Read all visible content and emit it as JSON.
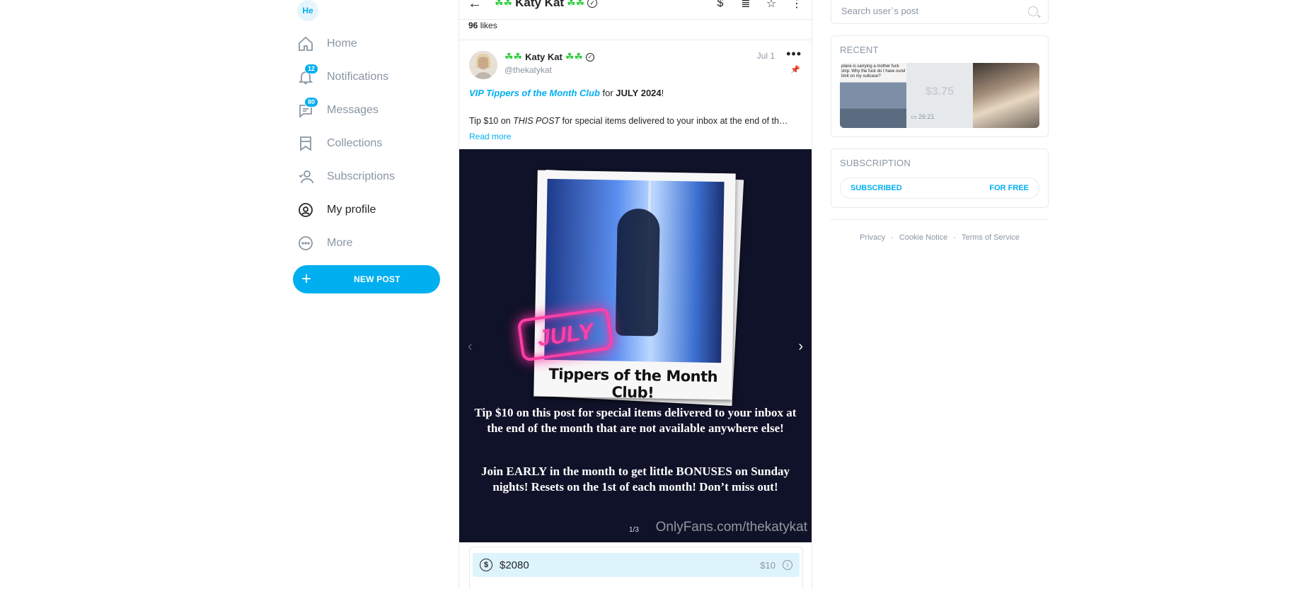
{
  "sidebar": {
    "avatar_initials": "He",
    "items": [
      {
        "label": "Home",
        "icon": "home-icon"
      },
      {
        "label": "Notifications",
        "icon": "bell-icon",
        "badge": "12"
      },
      {
        "label": "Messages",
        "icon": "message-icon",
        "badge": "80"
      },
      {
        "label": "Collections",
        "icon": "bookmark-icon"
      },
      {
        "label": "Subscriptions",
        "icon": "subscriptions-icon"
      },
      {
        "label": "My profile",
        "icon": "profile-icon",
        "active": true
      },
      {
        "label": "More",
        "icon": "more-icon"
      }
    ],
    "new_post_label": "NEW POST"
  },
  "topbar": {
    "title": "Katy Kat",
    "decor": "☘ ☘"
  },
  "post": {
    "likes_count": "96",
    "likes_label": "likes",
    "author_name": "Katy Kat",
    "author_handle": "@thekatykat",
    "date": "Jul 1",
    "text_link": "VIP Tippers of the Month Club",
    "text_for": " for ",
    "text_month": "JULY 2024",
    "text_excl": "!",
    "text_line2_pre": "Tip $10 on ",
    "text_line2_em": "THIS POST",
    "text_line2_post": " for special items delivered to your inbox at the end of th…",
    "read_more": "Read more",
    "media": {
      "stamp": "JULY",
      "caption": "Tippers of the Month Club!",
      "body1": "Tip $10 on this post for special items delivered to your inbox at the end of the month that are not available anywhere else!",
      "body2": "Join EARLY in the month to get little BONUSES on Sunday nights!  Resets on the 1st of each month! Don’t miss out!",
      "watermark": "OnlyFans.com/thekatykat",
      "counter": "1/3"
    },
    "tip": {
      "total": "$2080",
      "price": "$10"
    }
  },
  "right": {
    "search_placeholder": "Search user`s post",
    "recent_title": "RECENT",
    "recent": {
      "thumb1_text": "plane is carrying a mother fuck ship. Why the fuck do I have ound limit on my suitcase?",
      "thumb2_price": "$3.75",
      "thumb2_duration": "26:21"
    },
    "subscription_title": "SUBSCRIPTION",
    "subscribed_label": "SUBSCRIBED",
    "free_label": "FOR FREE",
    "footer": {
      "privacy": "Privacy",
      "cookie": "Cookie Notice",
      "terms": "Terms of Service"
    }
  }
}
